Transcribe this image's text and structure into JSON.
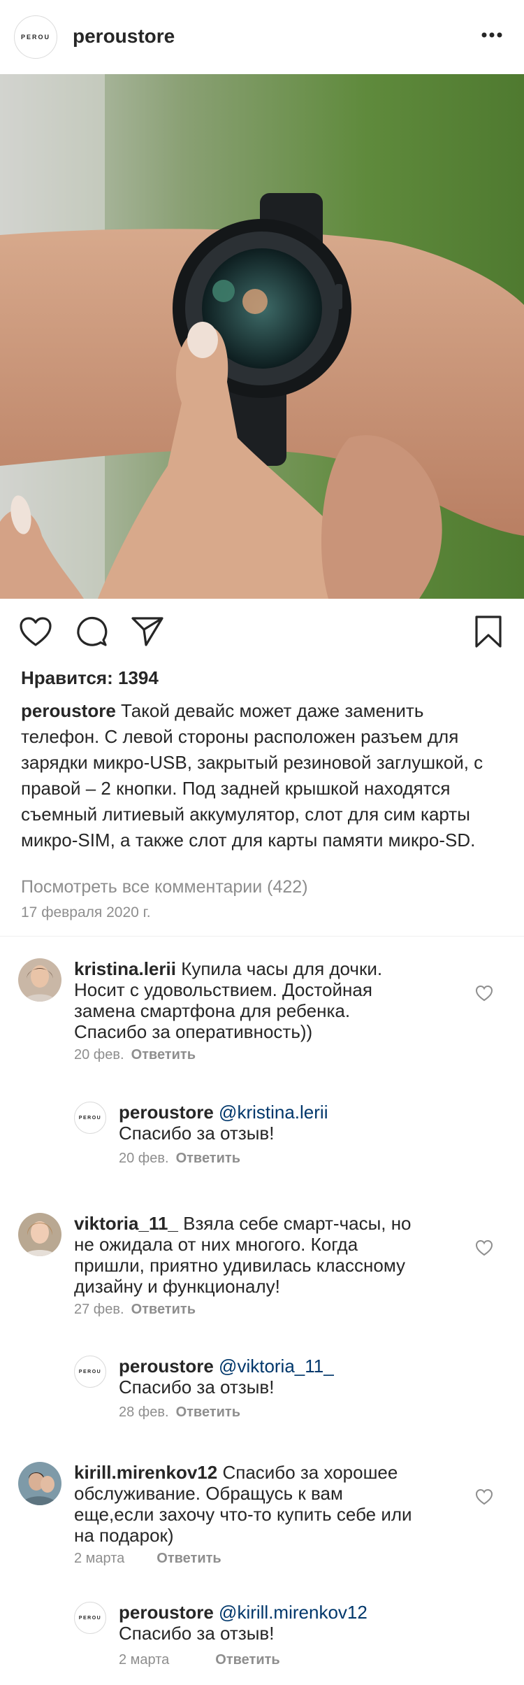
{
  "header": {
    "username": "peroustore",
    "logo_text": "PEROU",
    "more_icon": "more-horizontal-icon"
  },
  "post": {
    "likes_label": "Нравится: 1394",
    "caption_user": "peroustore",
    "caption_text": "Такой девайс может даже заменить телефон. С левой стороны расположен разъем для зарядки микро-USB, закрытый резиновой заглушкой, с правой – 2 кнопки. Под задней крышкой находятся съемный литиевый аккумулятор, слот для сим карты микро-SIM, а также слот для карты памяти микро-SD.",
    "view_all_comments": "Посмотреть все комментарии (422)",
    "date": "17 февраля 2020 г."
  },
  "comments": [
    {
      "user": "kristina.lerii",
      "lines": [
        "Купила часы для дочки.",
        "Носит с удовольствием. Достойная",
        "замена смартфона для ребенка.",
        "Спасибо за оперативность))"
      ],
      "date": "20 фев.",
      "reply_label": "Ответить",
      "reply": {
        "user": "peroustore",
        "mention": "@kristina.lerii",
        "text": "Спасибо за отзыв!",
        "date": "20 фев.",
        "reply_label": "Ответить"
      }
    },
    {
      "user": "viktoria_11_",
      "lines": [
        "Взяла себе смарт-часы, но",
        "не ожидала от них многого. Когда",
        "пришли, приятно удивилась классному",
        "дизайну и функционалу!"
      ],
      "date": "27 фев.",
      "reply_label": "Ответить",
      "reply": {
        "user": "peroustore",
        "mention": "@viktoria_11_",
        "text": "Спасибо за отзыв!",
        "date": "28 фев.",
        "reply_label": "Ответить"
      }
    },
    {
      "user": "kirill.mirenkov12",
      "lines": [
        "Спасибо за хорошее",
        "обслуживание. Обращусь к вам",
        "еще,если захочу что-то купить себе или",
        "на подарок)"
      ],
      "date": "2 марта",
      "reply_label": "Ответить",
      "reply": {
        "user": "peroustore",
        "mention": "@kirill.mirenkov12",
        "text": "Спасибо за отзыв!",
        "date": "2 марта",
        "reply_label": "Ответить"
      }
    }
  ]
}
